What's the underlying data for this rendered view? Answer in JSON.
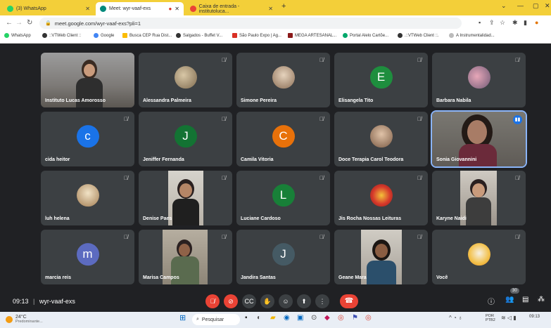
{
  "tabs": [
    {
      "label": "(3) WhatsApp",
      "color": "#25d366"
    },
    {
      "label": "Meet: wyr-vaaf-exs",
      "color": "#00897b"
    },
    {
      "label": "Caixa de entrada - institutoluca...",
      "color": "#ea4335"
    }
  ],
  "new_tab": "+",
  "url": "meet.google.com/wyr-vaaf-exs?pli=1",
  "bookmarks": [
    "WhatsApp",
    "::VTWeb Client ::",
    "Google",
    "Busca CEP Rua Dist...",
    "Salgados - Buffet V...",
    "São Paulo Expo | Ag...",
    "MEGA ARTESANAL...",
    "Portal Alelo Cartõe...",
    ".::VTWeb Client ::.",
    "A Instrumentalidad..."
  ],
  "participants": [
    {
      "name": "Instituto Lucas Amorosso",
      "kind": "video"
    },
    {
      "name": "Alessandra Palmeira",
      "kind": "photo"
    },
    {
      "name": "Simone Pereira",
      "kind": "photo"
    },
    {
      "name": "Elisangela Tito",
      "kind": "letter",
      "letter": "E",
      "color": "#1e8e3e"
    },
    {
      "name": "Barbara Nabila",
      "kind": "photo"
    },
    {
      "name": "cida heitor",
      "kind": "letter",
      "letter": "c",
      "color": "#1a73e8"
    },
    {
      "name": "Jeniffer Fernanda",
      "kind": "letter",
      "letter": "J",
      "color": "#137333"
    },
    {
      "name": "Camila Vitoria",
      "kind": "letter",
      "letter": "C",
      "color": "#e8710a"
    },
    {
      "name": "Doce Terapia Carol Teodora",
      "kind": "photo"
    },
    {
      "name": "Sonia Giovannini",
      "kind": "video"
    },
    {
      "name": "luh helena",
      "kind": "photo"
    },
    {
      "name": "Denise Paes",
      "kind": "video"
    },
    {
      "name": "Luciane Cardoso",
      "kind": "letter",
      "letter": "L",
      "color": "#188038"
    },
    {
      "name": "Jis Rocha Nossas Leituras",
      "kind": "logo"
    },
    {
      "name": "Karyne Naidi",
      "kind": "video"
    },
    {
      "name": "marcia reis",
      "kind": "letter",
      "letter": "m",
      "color": "#5c6bc0"
    },
    {
      "name": "Marisa Campos",
      "kind": "video"
    },
    {
      "name": "Jandira Santas",
      "kind": "letter",
      "letter": "J",
      "color": "#455a64"
    },
    {
      "name": "Geane Mara",
      "kind": "video"
    },
    {
      "name": "Você",
      "kind": "logo"
    }
  ],
  "meeting": {
    "time": "09:13",
    "separator": "|",
    "code": "wyr-vaaf-exs"
  },
  "participant_count": "30",
  "taskbar": {
    "weather_temp": "24°C",
    "weather_desc": "Predominante...",
    "search": "Pesquisar",
    "lang": "POR",
    "lang2": "PTB2",
    "clock": "09:13"
  }
}
